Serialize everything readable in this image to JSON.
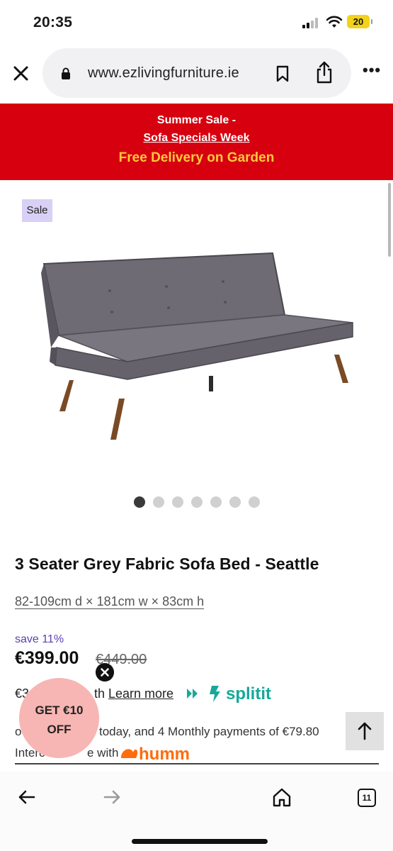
{
  "status_bar": {
    "time": "20:35",
    "battery": "20"
  },
  "browser": {
    "url": "www.ezlivingfurniture.ie",
    "tabs_count": "11"
  },
  "promo": {
    "line1": "Summer Sale -",
    "line2": "Sofa Specials Week",
    "line3": "Free Delivery on Garden",
    "bg_color": "#d7000f",
    "highlight_color": "#ffc93c"
  },
  "product": {
    "badge": "Sale",
    "title": "3 Seater Grey Fabric Sofa Bed - Seattle",
    "dimensions": "82-109cm d × 181cm w × 83cm h",
    "save": "save 11%",
    "price": "€399.00",
    "was_price": "€449.00",
    "image_count": 7,
    "active_image": 1
  },
  "payments": {
    "splitit_prefix": "€3",
    "splitit_mid": "th",
    "learn_more": "Learn more",
    "splitit_logo_text": "splitit",
    "humm_prefix": "o",
    "humm_text": "today, and 4 Monthly payments of €79.80",
    "humm_line2": "Interc",
    "humm_line2b": "e with",
    "humm_logo_text": "humm"
  },
  "popup": {
    "line1": "GET €10",
    "line2": "OFF",
    "color": "#f7b6b3"
  }
}
